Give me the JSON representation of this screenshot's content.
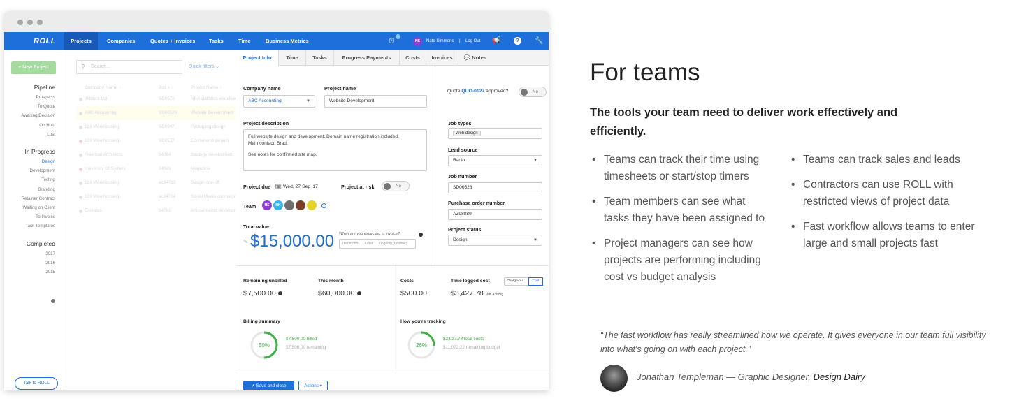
{
  "nav": {
    "logo": "ROLL",
    "items": [
      "Projects",
      "Companies",
      "Quotes + Invoices",
      "Tasks",
      "Time",
      "Business Metrics"
    ],
    "user_initials": "NS",
    "user_name": "Nate Simmons",
    "separator": "|",
    "logout": "Log Out",
    "timer_badge": "1"
  },
  "sidebar": {
    "new_project": "+ New Project",
    "pipeline": {
      "title": "Pipeline",
      "items": [
        "Prospects",
        "To Quote",
        "Awaiting Decision",
        "On Hold",
        "Lost"
      ]
    },
    "in_progress": {
      "title": "In Progress",
      "items": [
        "Design",
        "Development",
        "Testing",
        "Branding",
        "Retainer Contract",
        "Waiting on Client",
        "To Invoice",
        "Task Templates"
      ]
    },
    "completed": {
      "title": "Completed",
      "items": [
        "2017",
        "2016",
        "2015"
      ]
    },
    "talk": "Talk to ROLL"
  },
  "list": {
    "search_placeholder": "Search...",
    "quick_filters": "Quick filters ⌄",
    "headers": [
      "Company Name ↑",
      "Job # ↑",
      "Project Name ↑"
    ],
    "rows": [
      {
        "company": "96block Ltd",
        "job": "SD0576",
        "project": "NBA statistics visualise"
      },
      {
        "company": "ABC Accounting",
        "job": "SD00528",
        "project": "Website Development"
      },
      {
        "company": "123 Warehousing",
        "job": "SD0547",
        "project": "Packaging design"
      },
      {
        "company": "123 Warehousing",
        "job": "SD0537",
        "project": "Ecommerce project"
      },
      {
        "company": "Freeman Architects",
        "job": "34084",
        "project": "Strategy development"
      },
      {
        "company": "University Of Sydney",
        "job": "34083",
        "project": "Magazine"
      },
      {
        "company": "123 Warehousing",
        "job": "ac34713",
        "project": "Design one-off"
      },
      {
        "company": "123 Warehousing",
        "job": "ac34714",
        "project": "Social Media campaign"
      },
      {
        "company": "Emirates",
        "job": "34781",
        "project": "Annual report development"
      }
    ]
  },
  "tabs": [
    "Project Info",
    "Time",
    "Tasks",
    "Progress Payments",
    "Costs",
    "Invoices",
    "Notes"
  ],
  "form": {
    "company_label": "Company name",
    "company_value": "ABC Accounting",
    "project_label": "Project name",
    "project_value": "Website Development",
    "desc_label": "Project description",
    "desc_line1": "Full website design and development. Domain name registration included.",
    "desc_line2": "Main contact: Brad.",
    "desc_line3": "See notes for confirmed site map.",
    "due_label": "Project due",
    "due_value": "Wed, 27 Sep '17",
    "risk_label": "Project at risk",
    "risk_toggle": "No",
    "team_label": "Team",
    "team": [
      "NS",
      "NK"
    ],
    "total_label": "Total value",
    "total_value": "$15,000.00",
    "invoice_q": "When are you expecting to invoice?",
    "invoice_opts": [
      "This month",
      "Later",
      "Ongoing (retainer)"
    ],
    "quote_prefix": "Quote",
    "quote_id": "QUO-0127",
    "quote_suffix": "approved?",
    "quote_toggle": "No",
    "job_types_label": "Job types",
    "job_types_value": "Web design",
    "lead_label": "Lead source",
    "lead_value": "Radio",
    "jobnum_label": "Job number",
    "jobnum_value": "SD00528",
    "po_label": "Purchase order number",
    "po_value": "AZ98889",
    "status_label": "Project status",
    "status_value": "Design"
  },
  "stats": {
    "unbilled_label": "Remaining unbilled",
    "unbilled_value": "$7,500.00",
    "month_label": "This month",
    "month_value": "$60,000.00",
    "costs_label": "Costs",
    "costs_value": "$500.00",
    "timecost_label": "Time logged cost",
    "timecost_value": "$3,427.78",
    "timecost_hours": "(68.33hrs)",
    "toggle_a": "Charge-out",
    "toggle_b": "Cost"
  },
  "billing": {
    "label": "Billing summary",
    "pct_value": 50,
    "pct_text": "50%",
    "line1": "$7,500.00 billed",
    "line2": "$7,500.00 remaining"
  },
  "tracking": {
    "label": "How you're tracking",
    "pct_value": 26,
    "pct_text": "26%",
    "line1": "$3,927.78 total costs",
    "line2": "$11,072.22 remaining budget"
  },
  "buttons": {
    "save": "Save and close",
    "actions": "Actions ▾"
  },
  "marketing": {
    "title": "For teams",
    "subtitle": "The tools your team need to deliver work effectively and efficiently.",
    "col1": [
      "Teams can track their time using timesheets or start/stop timers",
      "Team members can see what tasks they have been assigned to",
      "Project managers can see how projects are performing including cost vs budget analysis"
    ],
    "col2": [
      "Teams can track sales and leads",
      "Contractors can use ROLL with restricted views of project data",
      "Fast workflow allows teams to enter large and small projects fast"
    ],
    "quote": "“The fast workflow has really streamlined how we operate. It gives everyone in our team full visibility into what's going on with each project.”",
    "author": "Jonathan Templeman — Graphic Designer,",
    "company": "Design Dairy"
  },
  "colors": {
    "brand_blue": "#1e6fd9",
    "green": "#3cb043"
  }
}
